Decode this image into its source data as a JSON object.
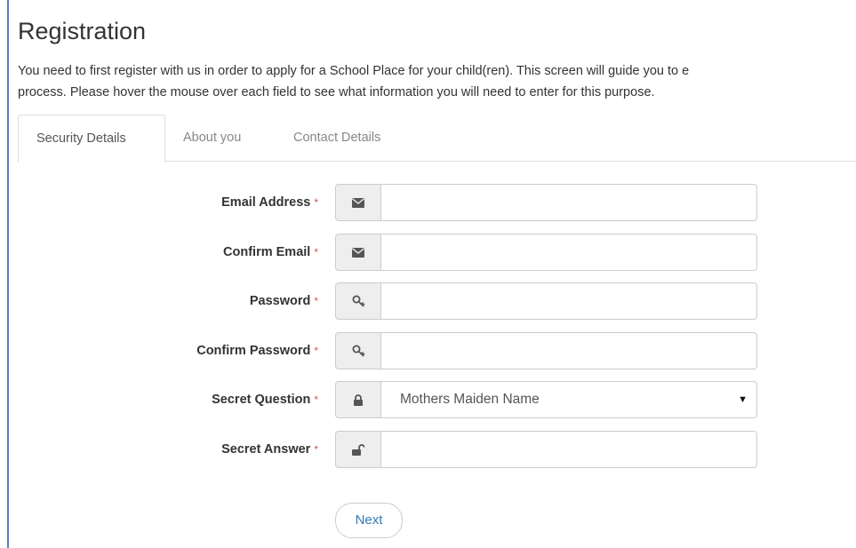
{
  "page": {
    "title": "Registration",
    "intro_line1": "You need to first register with us in order to apply for a School Place for your child(ren). This screen will guide you to e",
    "intro_line2": "process. Please hover the mouse over each field to see what information you will need to enter for this purpose."
  },
  "tabs": [
    {
      "label": "Security Details",
      "active": true
    },
    {
      "label": "About you",
      "active": false
    },
    {
      "label": "Contact Details",
      "active": false
    }
  ],
  "form": {
    "required_marker": "*",
    "fields": [
      {
        "label": "Email Address",
        "icon": "envelope-icon",
        "value": ""
      },
      {
        "label": "Confirm Email",
        "icon": "envelope-icon",
        "value": ""
      },
      {
        "label": "Password",
        "icon": "key-icon",
        "value": ""
      },
      {
        "label": "Confirm Password",
        "icon": "key-icon",
        "value": ""
      },
      {
        "label": "Secret Question",
        "icon": "lock-icon",
        "value": "Mothers Maiden Name"
      },
      {
        "label": "Secret Answer",
        "icon": "unlock-icon",
        "value": ""
      }
    ],
    "next_label": "Next"
  },
  "colors": {
    "accent": "#337ab7",
    "required": "#d9534f",
    "frame": "#5b7fc0"
  }
}
